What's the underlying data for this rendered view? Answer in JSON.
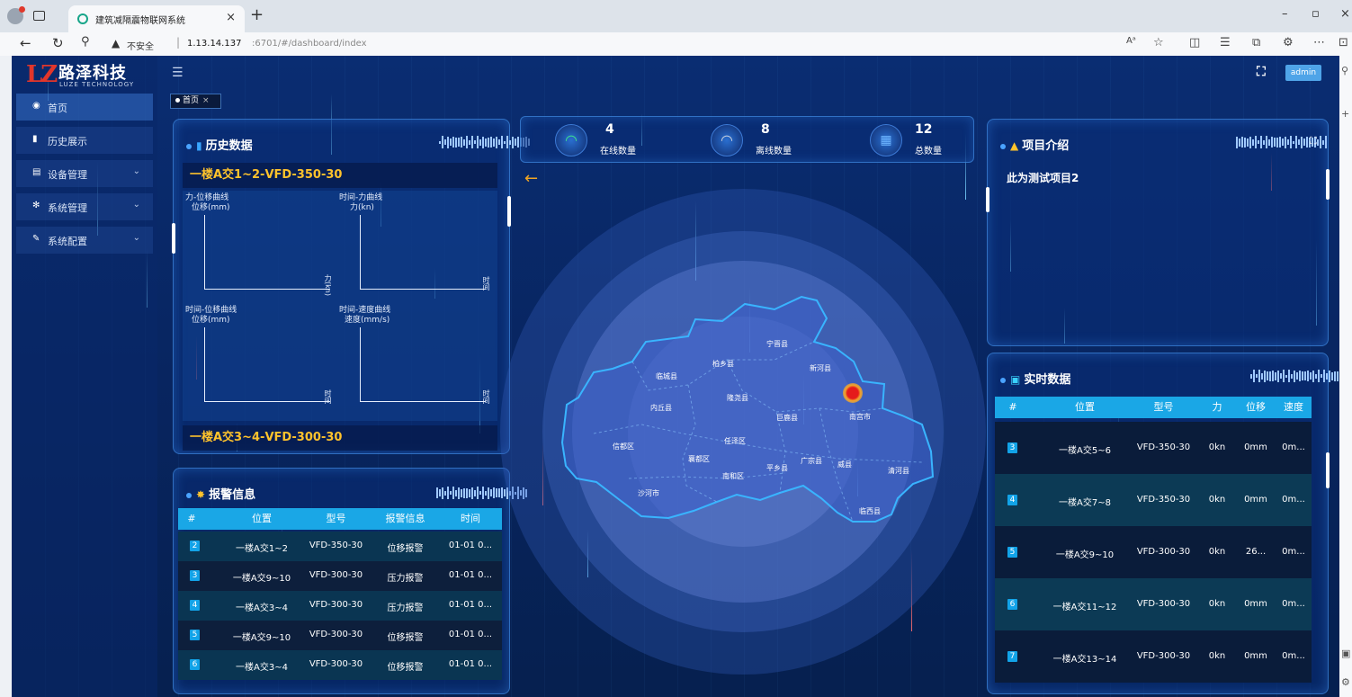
{
  "browser": {
    "tab_title": "建筑减隔震物联网系统",
    "not_secure": "不安全",
    "url_host": "1.13.14.137",
    "url_path": ":6701/#/dashboard/index"
  },
  "app": {
    "logo_cn": "路泽科技",
    "logo_en": "LUZE TECHNOLOGY",
    "logo_mark": "LZ",
    "user": "admin",
    "tag": "首页"
  },
  "sidebar": {
    "items": [
      {
        "label": "首页",
        "icon": "dashboard-icon"
      },
      {
        "label": "历史展示",
        "icon": "bar-chart-icon"
      },
      {
        "label": "设备管理",
        "icon": "device-icon"
      },
      {
        "label": "系统管理",
        "icon": "gear-icon"
      },
      {
        "label": "系统配置",
        "icon": "edit-icon"
      }
    ]
  },
  "history": {
    "title": "历史数据",
    "device1": "一楼A交1~2-VFD-350-30",
    "device2": "一楼A交3~4-VFD-300-30",
    "charts": [
      {
        "title": "力-位移曲线",
        "ylabel": "位移(mm)",
        "xlabel": "力(kn)"
      },
      {
        "title": "时间-力曲线",
        "ylabel": "力(kn)",
        "xlabel": "时间"
      },
      {
        "title": "时间-位移曲线",
        "ylabel": "位移(mm)",
        "xlabel": "时间"
      },
      {
        "title": "时间-速度曲线",
        "ylabel": "速度(mm/s)",
        "xlabel": "时间"
      }
    ]
  },
  "alarm": {
    "title": "报警信息",
    "columns": [
      "#",
      "位置",
      "型号",
      "报警信息",
      "时间"
    ],
    "rows": [
      [
        "2",
        "一楼A交1~2",
        "VFD-350-30",
        "位移报警",
        "01-01 0..."
      ],
      [
        "3",
        "一楼A交9~10",
        "VFD-300-30",
        "压力报警",
        "01-01 0..."
      ],
      [
        "4",
        "一楼A交3~4",
        "VFD-300-30",
        "压力报警",
        "01-01 0..."
      ],
      [
        "5",
        "一楼A交9~10",
        "VFD-300-30",
        "位移报警",
        "01-01 0..."
      ],
      [
        "6",
        "一楼A交3~4",
        "VFD-300-30",
        "位移报警",
        "01-01 0..."
      ]
    ]
  },
  "stats": [
    {
      "value": "4",
      "label": "在线数量",
      "icon": "wifi-icon"
    },
    {
      "value": "8",
      "label": "离线数量",
      "icon": "wifi-off-icon"
    },
    {
      "value": "12",
      "label": "总数量",
      "icon": "grid-icon"
    }
  ],
  "map": {
    "districts": [
      "宁晋县",
      "柏乡县",
      "新河县",
      "临城县",
      "隆尧县",
      "内丘县",
      "巨鹿县",
      "南宫市",
      "任泽区",
      "信都区",
      "襄都区",
      "广宗县",
      "威县",
      "清河县",
      "南和区",
      "平乡县",
      "沙河市",
      "临西县"
    ]
  },
  "project": {
    "title": "项目介绍",
    "text": "此为测试项目2"
  },
  "realtime": {
    "title": "实时数据",
    "columns": [
      "#",
      "位置",
      "型号",
      "力",
      "位移",
      "速度"
    ],
    "rows": [
      [
        "3",
        "一楼A交5~6",
        "VFD-350-30",
        "0kn",
        "0mm",
        "0m..."
      ],
      [
        "4",
        "一楼A交7~8",
        "VFD-350-30",
        "0kn",
        "0mm",
        "0m..."
      ],
      [
        "5",
        "一楼A交9~10",
        "VFD-300-30",
        "0kn",
        "26...",
        "0m..."
      ],
      [
        "6",
        "一楼A交11~12",
        "VFD-300-30",
        "0kn",
        "0mm",
        "0m..."
      ],
      [
        "7",
        "一楼A交13~14",
        "VFD-300-30",
        "0kn",
        "0mm",
        "0m..."
      ]
    ]
  },
  "colors": {
    "accent": "#1aa7e6",
    "gold": "#ffc32c",
    "alarm_pin": "#e51b1b",
    "background": "#082560"
  }
}
